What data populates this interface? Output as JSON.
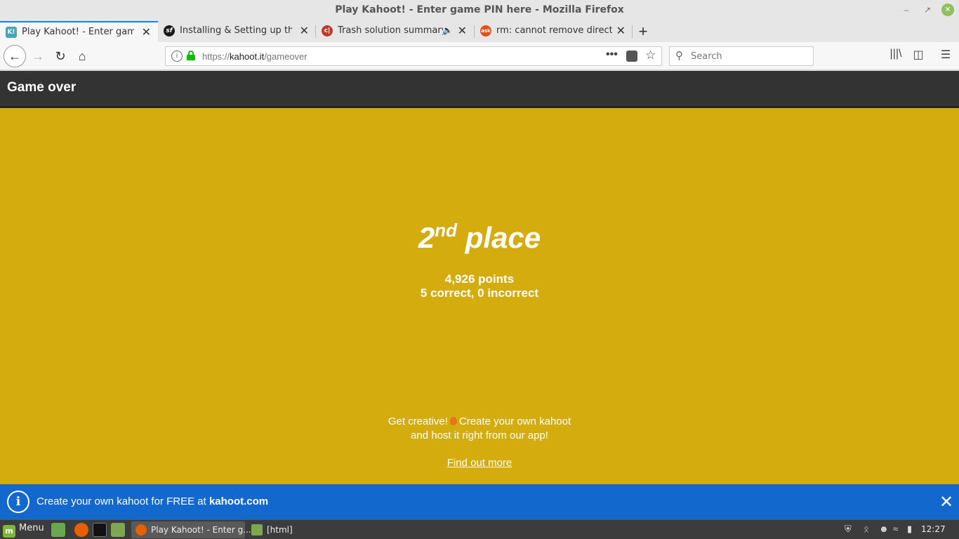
{
  "window": {
    "title": "Play Kahoot! - Enter game PIN here - Mozilla Firefox",
    "minimize_icon": "minimize-icon",
    "maximize_icon": "maximize-icon",
    "close_icon": "close-icon"
  },
  "tabs": [
    {
      "label": "Play Kahoot! - Enter game PIN here",
      "favicon": "K!",
      "favicon_color": "#46a6b8",
      "active": true
    },
    {
      "label": "Installing & Setting up the Symfony Framework",
      "favicon": "sf",
      "favicon_color": "#1a1a1a",
      "active": false
    },
    {
      "label": "Trash solution summary: Chrome",
      "favicon": "c|",
      "favicon_color": "#c0392b",
      "active": false,
      "audio": true
    },
    {
      "label": "rm: cannot remove directory/: Device or resource busy",
      "favicon": "ask",
      "favicon_color": "#e2511a",
      "active": false
    }
  ],
  "nav": {
    "url_prefix": "https://",
    "url_domain": "kahoot.it",
    "url_path": "/gameover",
    "search_placeholder": "Search"
  },
  "page": {
    "header_title": "Game over",
    "place_number": "2",
    "place_suffix": "nd",
    "place_word": "place",
    "points": "4,926 points",
    "correct_line": "5 correct, 0 incorrect",
    "promo_line1_a": "Get creative!",
    "promo_line1_b": "Create your own kahoot",
    "promo_line2": "and host it right from our app!",
    "find_out_more": "Find out more",
    "background_color": "#d4ac0d"
  },
  "banner": {
    "text_prefix": "Create your own kahoot for FREE at ",
    "text_link": "kahoot.com",
    "info_glyph": "i",
    "color": "#1368ce"
  },
  "taskbar": {
    "menu_label": "Menu",
    "windows": [
      {
        "label": "Play Kahoot! - Enter g...",
        "active": true
      },
      {
        "label": "[html]",
        "active": false
      }
    ],
    "clock": "12:27"
  }
}
